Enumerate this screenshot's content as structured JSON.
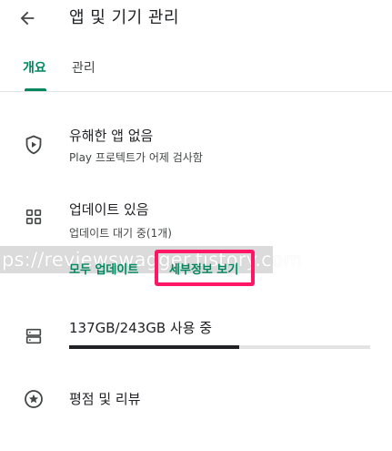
{
  "header": {
    "back_icon": "arrow-left-icon",
    "title": "앱 및 기기 관리"
  },
  "tabs": [
    {
      "label": "개요",
      "selected": true
    },
    {
      "label": "관리",
      "selected": false
    }
  ],
  "protect": {
    "icon": "shield-play-icon",
    "title": "유해한 앱 없음",
    "subtitle": "Play 프로텍트가 어제 검사함"
  },
  "updates": {
    "icon": "apps-grid-icon",
    "title": "업데이트 있음",
    "subtitle": "업데이트 대기 중(1개)",
    "update_all_label": "모두 업데이트",
    "details_label": "세부정보 보기"
  },
  "storage": {
    "icon": "storage-icon",
    "text": "137GB/243GB 사용 중",
    "used_fraction": 0.5638
  },
  "ratings": {
    "icon": "star-circle-icon",
    "title": "평점 및 리뷰"
  },
  "watermark": {
    "text": "ps://reviewswagger.tistory.com"
  },
  "colors": {
    "accent": "#01875f",
    "highlight": "#ff1766",
    "progress": "#202124"
  }
}
